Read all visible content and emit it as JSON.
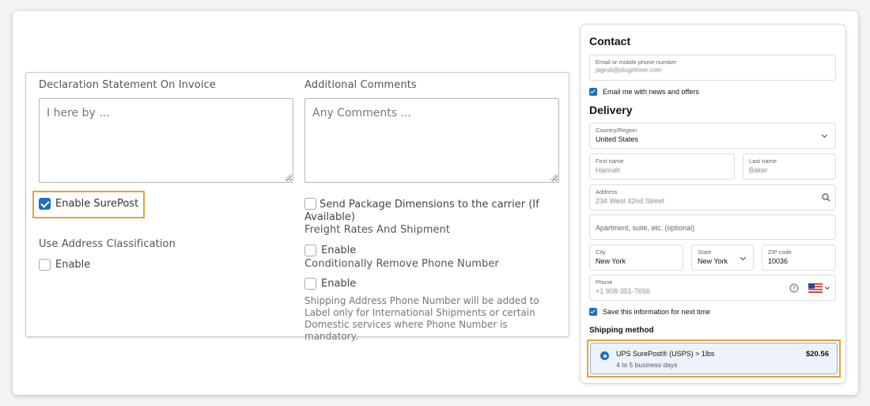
{
  "settings": {
    "declaration_label": "Declaration Statement On Invoice",
    "declaration_placeholder": "I here by ...",
    "comments_label": "Additional Comments",
    "comments_placeholder": "Any Comments ...",
    "surepost_label": "Enable SurePost",
    "address_class_label": "Use Address Classification",
    "address_class_enable": "Enable",
    "dims_label": "Send Package Dimensions to the carrier (If Available)",
    "freight_label": "Freight Rates And Shipment",
    "freight_enable": "Enable",
    "phone_label": "Conditionally Remove Phone Number",
    "phone_enable": "Enable",
    "phone_help": "Shipping Address Phone Number will be added to Label only for International Shipments or certain Domestic services where Phone Number is mandatory."
  },
  "checkout": {
    "contact_title": "Contact",
    "email_label": "Email or mobile phone number",
    "email_value": "jagruti@pluginhive.com",
    "news_label": "Email me with news and offers",
    "delivery_title": "Delivery",
    "country_label": "Country/Region",
    "country_value": "United States",
    "first_label": "First name",
    "first_value": "Hannah",
    "last_label": "Last name",
    "last_value": "Baker",
    "address_label": "Address",
    "address_value": "234 West 42nd Street",
    "apt_placeholder": "Apartment, suite, etc. (optional)",
    "city_label": "City",
    "city_value": "New York",
    "state_label": "State",
    "state_value": "New York",
    "zip_label": "ZIP code",
    "zip_value": "10036",
    "phone_label": "Phone",
    "phone_value": "+1 908-351-7656",
    "save_label": "Save this information for next time",
    "shipping_title": "Shipping method",
    "ship_name": "UPS SurePost® (USPS) > 1lbs",
    "ship_eta": "4 to 5 business days",
    "ship_price": "$20.56"
  },
  "colors": {
    "accent": "#1a6fc4",
    "highlight": "#e2a33a"
  }
}
